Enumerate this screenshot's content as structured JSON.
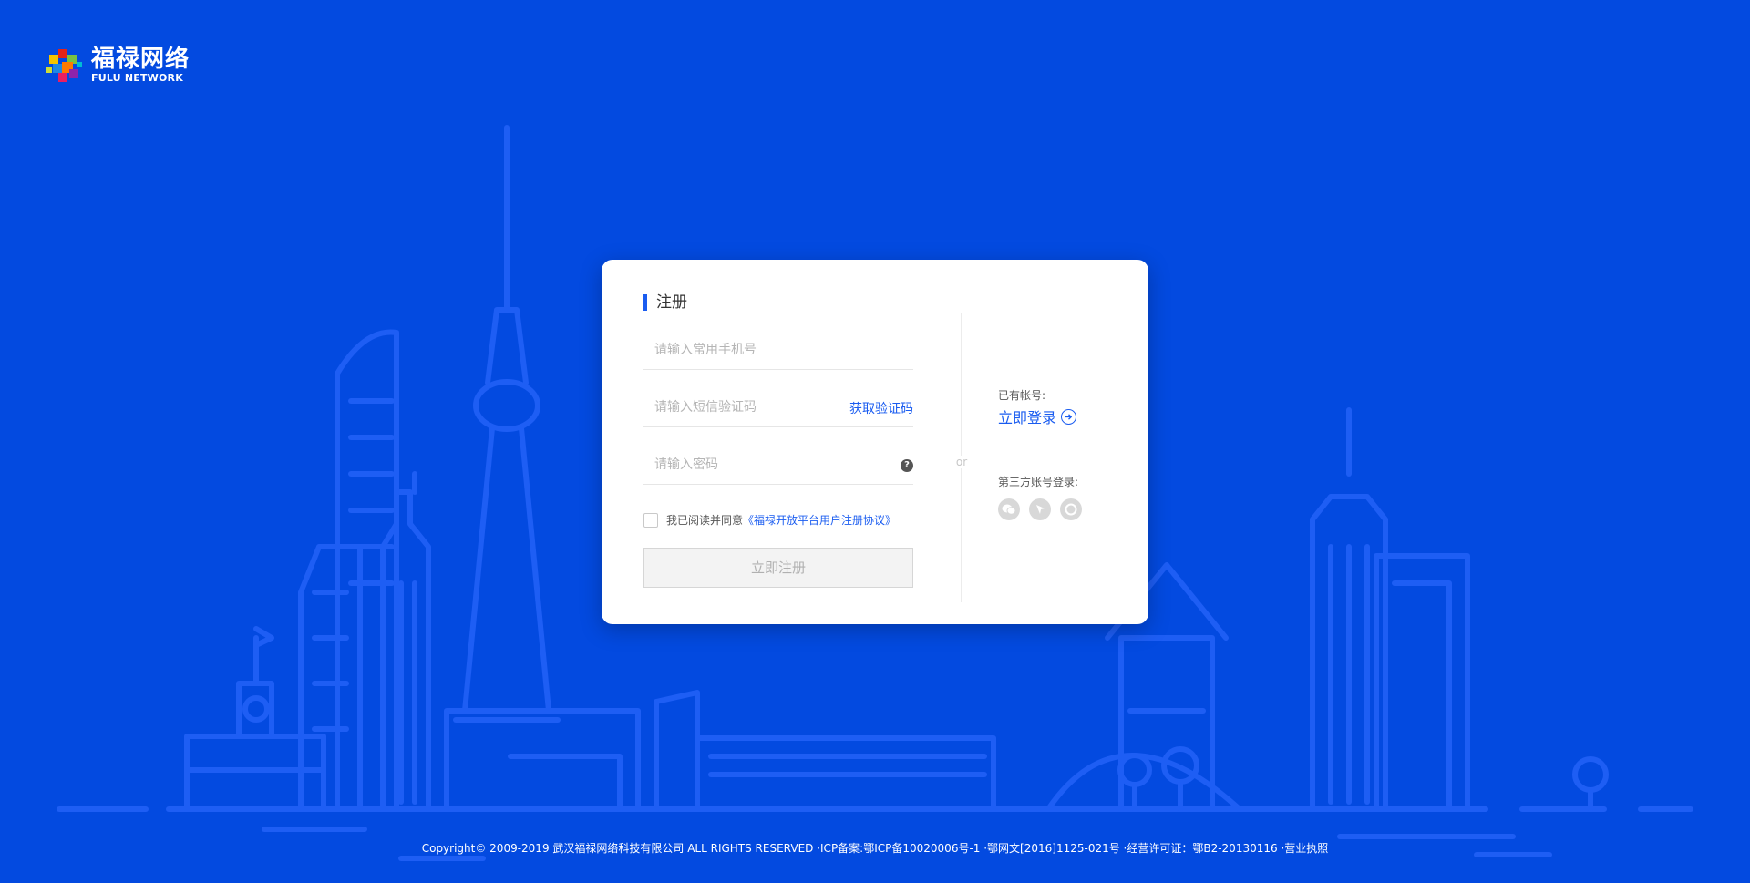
{
  "brand": {
    "name_cn": "福禄网络",
    "name_en": "FULU NETWORK"
  },
  "form": {
    "title": "注册",
    "phone_placeholder": "请输入常用手机号",
    "code_placeholder": "请输入短信验证码",
    "get_code_label": "获取验证码",
    "password_placeholder": "请输入密码",
    "help_label": "?",
    "agree_text": "我已阅读并同意",
    "agree_link": "《福禄开放平台用户注册协议》",
    "submit_label": "立即注册"
  },
  "side": {
    "or_label": "or",
    "has_account_label": "已有帐号:",
    "login_label": "立即登录",
    "third_party_label": "第三方账号登录:",
    "social_icons": [
      "wechat-icon",
      "weibo-icon",
      "qq-icon"
    ]
  },
  "footer": {
    "text": "Copyright© 2009-2019 武汉福禄网络科技有限公司 ALL RIGHTS RESERVED ·ICP备案:鄂ICP备10020006号-1 ·鄂网文[2016]1125-021号 ·经营许可证：鄂B2-20130116 ·营业执照"
  },
  "colors": {
    "background": "#034ae0",
    "accent": "#1a5cf0",
    "skyline_line": "#1d5cf4"
  }
}
